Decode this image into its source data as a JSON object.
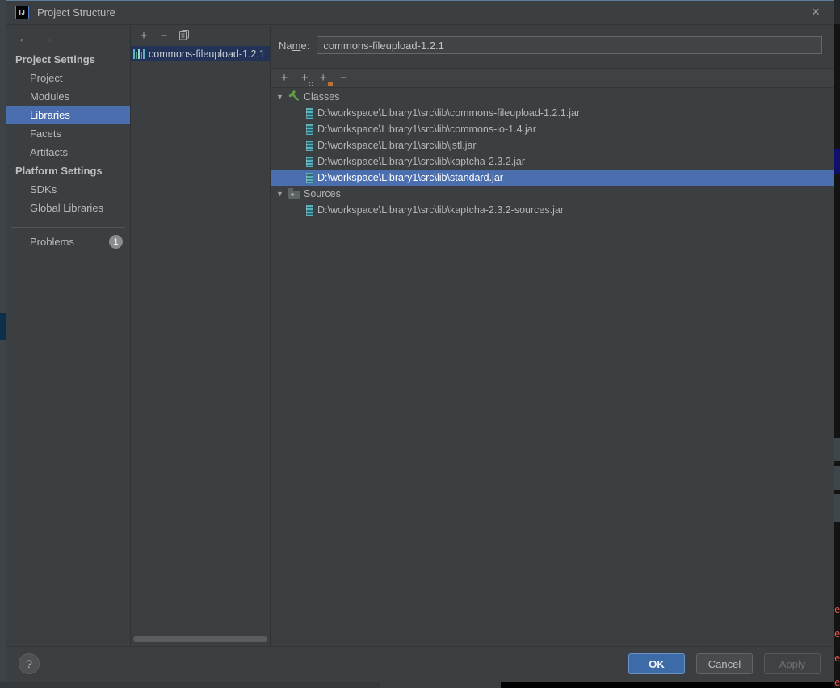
{
  "icons": {
    "back": "←",
    "forward": "→",
    "add": "+",
    "remove": "−",
    "expander": "▼",
    "close": "×",
    "help": "?"
  },
  "titlebar": {
    "title": "Project Structure",
    "app_icon_text": "IJ"
  },
  "sidebar": {
    "sections": [
      {
        "header": "Project Settings",
        "items": [
          {
            "label": "Project",
            "selected": false
          },
          {
            "label": "Modules",
            "selected": false
          },
          {
            "label": "Libraries",
            "selected": true
          },
          {
            "label": "Facets",
            "selected": false
          },
          {
            "label": "Artifacts",
            "selected": false
          }
        ]
      },
      {
        "header": "Platform Settings",
        "items": [
          {
            "label": "SDKs",
            "selected": false
          },
          {
            "label": "Global Libraries",
            "selected": false
          }
        ]
      }
    ],
    "problems": {
      "label": "Problems",
      "badge": "1"
    }
  },
  "library_list": {
    "selected_item": "commons-fileupload-1.2.1"
  },
  "editor": {
    "name_label": {
      "pre": "Na",
      "mnemonic": "m",
      "post": "e:"
    },
    "name_value": "commons-fileupload-1.2.1",
    "rows": [
      {
        "label": "Classes",
        "type": "classes-group",
        "selected": false
      },
      {
        "label": "D:\\workspace\\Library1\\src\\lib\\commons-fileupload-1.2.1.jar",
        "type": "jar",
        "selected": false
      },
      {
        "label": "D:\\workspace\\Library1\\src\\lib\\commons-io-1.4.jar",
        "type": "jar",
        "selected": false
      },
      {
        "label": "D:\\workspace\\Library1\\src\\lib\\jstl.jar",
        "type": "jar",
        "selected": false
      },
      {
        "label": "D:\\workspace\\Library1\\src\\lib\\kaptcha-2.3.2.jar",
        "type": "jar",
        "selected": false
      },
      {
        "label": "D:\\workspace\\Library1\\src\\lib\\standard.jar",
        "type": "jar",
        "selected": true
      },
      {
        "label": "Sources",
        "type": "sources-group",
        "selected": false
      },
      {
        "label": "D:\\workspace\\Library1\\src\\lib\\kaptcha-2.3.2-sources.jar",
        "type": "jar",
        "selected": false
      }
    ]
  },
  "footer": {
    "ok_label": "OK",
    "cancel_label": "Cancel",
    "apply_label": "Apply"
  },
  "background": {
    "error_fragments": [
      "e",
      "e",
      "e",
      "e"
    ]
  },
  "colors": {
    "focused_selection": "#4b6eaf",
    "list_selection": "#223357",
    "ok_button": "#3d6ba8",
    "dialog_bg": "#3c3f41",
    "dialog_border": "#5c7c99"
  }
}
